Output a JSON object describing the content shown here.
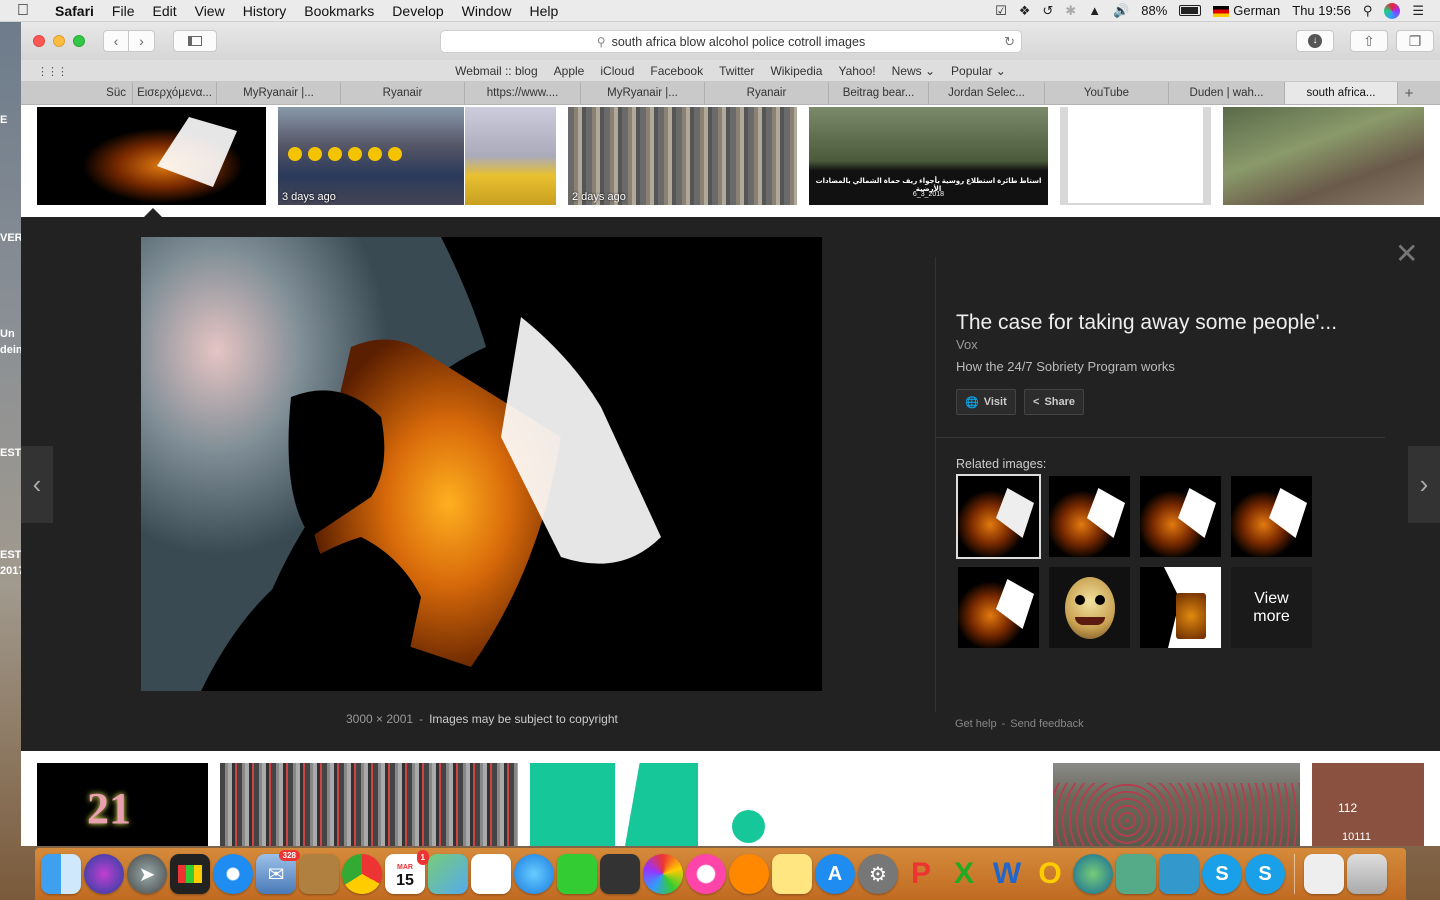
{
  "menubar": {
    "app": "Safari",
    "items": [
      "File",
      "Edit",
      "View",
      "History",
      "Bookmarks",
      "Develop",
      "Window",
      "Help"
    ],
    "battery": "88%",
    "input_source": "German",
    "clock": "Thu 19:56"
  },
  "desktop_fragments": [
    "E",
    "VER",
    "Un",
    "dein",
    "EST",
    "EST",
    "2017"
  ],
  "toolbar": {
    "address": "south africa  blow alcohol police cotroll images"
  },
  "favorites": [
    "Webmail :: blog",
    "Apple",
    "iCloud",
    "Facebook",
    "Twitter",
    "Wikipedia",
    "Yahoo!",
    "News",
    "Popular"
  ],
  "tabs": [
    "Süc",
    "Εισερχόμενα...",
    "MyRyanair |...",
    "Ryanair",
    "https://www....",
    "MyRyanair |...",
    "Ryanair",
    "Beitrag bear...",
    "Jordan Selec...",
    "YouTube",
    "Duden | wah...",
    "south africa..."
  ],
  "results_top": [
    {
      "age": ""
    },
    {
      "age": "3 days ago"
    },
    {
      "age": "2 days ago"
    },
    {
      "age": "",
      "overlay_text": "استاط طائرة استطلاع روسية بأجواء ريف حماة الشمالي بالمضادات الأرضية",
      "overlay_date": "6_3_2018"
    },
    {
      "age": ""
    },
    {
      "age": ""
    }
  ],
  "viewer": {
    "title": "The case for taking away some people'...",
    "source": "Vox",
    "description": "How the 24/7 Sobriety Program works",
    "visit_label": "Visit",
    "share_label": "Share",
    "dimensions": "3000 × 2001",
    "copyright": "Images may be subject to copyright",
    "related_label": "Related images:",
    "view_more": "View more",
    "help_label": "Get help",
    "feedback_label": "Send feedback"
  },
  "results_bottom": [
    {
      "text": "21"
    },
    {
      "text": ""
    },
    {
      "text": ""
    },
    {
      "text": ""
    },
    {
      "text": ""
    },
    {
      "text": "112",
      "text2": "10111"
    }
  ],
  "dock": {
    "mail_badge": "328",
    "calendar_month": "MAR",
    "calendar_day": "15",
    "calendar_badge": "1"
  }
}
